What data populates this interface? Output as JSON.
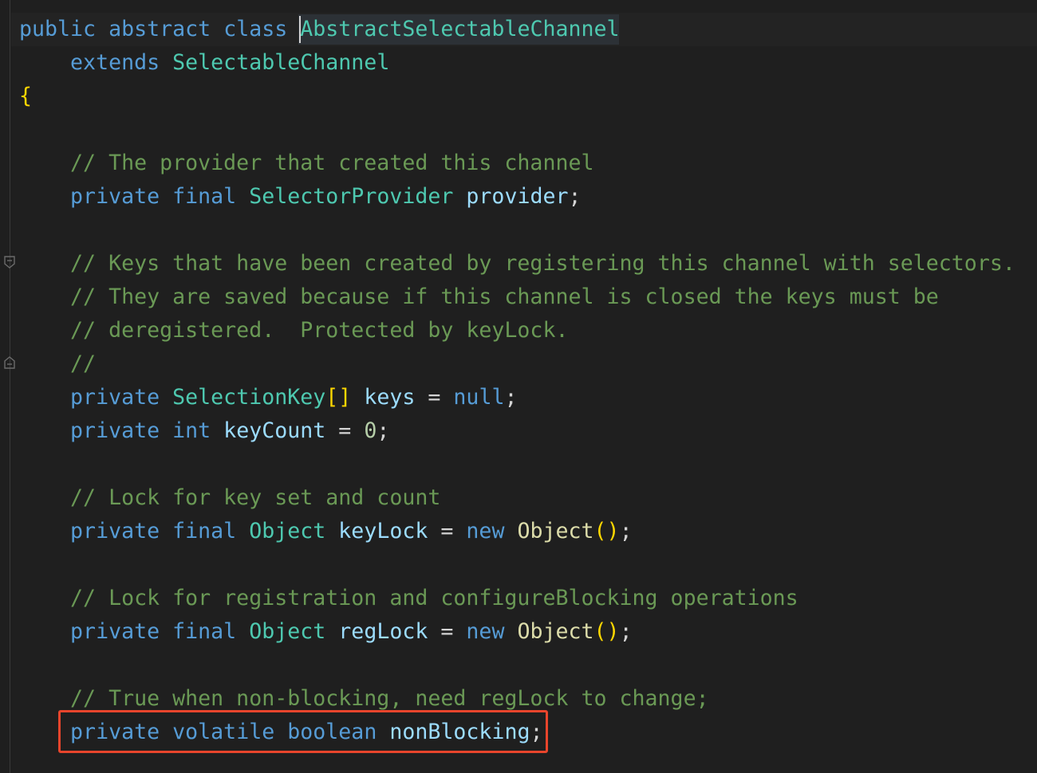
{
  "colors": {
    "background": "#1f1f1f",
    "keyword": "#569cd6",
    "type": "#4ec9b0",
    "variable": "#9cdcfe",
    "plain": "#d4d4d4",
    "comment": "#6a9955",
    "number": "#b5cea8",
    "function": "#dcdcaa",
    "bracket": "#ffd700",
    "highlight_box": "#e8452c"
  },
  "icons": [
    "fold-marker-icon"
  ],
  "code": {
    "lines": [
      [
        [
          "kw",
          "public "
        ],
        [
          "kw",
          "abstract "
        ],
        [
          "kw",
          "class "
        ],
        [
          "type",
          "AbstractSelectableChannel"
        ]
      ],
      [
        [
          "plain",
          "    "
        ],
        [
          "kw",
          "extends "
        ],
        [
          "type",
          "SelectableChannel"
        ]
      ],
      [
        [
          "br",
          "{"
        ]
      ],
      [],
      [
        [
          "plain",
          "    "
        ],
        [
          "cm",
          "// The provider that created this channel"
        ]
      ],
      [
        [
          "plain",
          "    "
        ],
        [
          "kw",
          "private "
        ],
        [
          "kw",
          "final "
        ],
        [
          "type",
          "SelectorProvider "
        ],
        [
          "var",
          "provider"
        ],
        [
          "plain",
          ";"
        ]
      ],
      [],
      [
        [
          "plain",
          "    "
        ],
        [
          "cm",
          "// Keys that have been created by registering this channel with selectors."
        ]
      ],
      [
        [
          "plain",
          "    "
        ],
        [
          "cm",
          "// They are saved because if this channel is closed the keys must be"
        ]
      ],
      [
        [
          "plain",
          "    "
        ],
        [
          "cm",
          "// deregistered.  Protected by keyLock."
        ]
      ],
      [
        [
          "plain",
          "    "
        ],
        [
          "cm",
          "//"
        ]
      ],
      [
        [
          "plain",
          "    "
        ],
        [
          "kw",
          "private "
        ],
        [
          "type",
          "SelectionKey"
        ],
        [
          "br",
          "[]"
        ],
        [
          "plain",
          " "
        ],
        [
          "var",
          "keys"
        ],
        [
          "plain",
          " = "
        ],
        [
          "kw",
          "null"
        ],
        [
          "plain",
          ";"
        ]
      ],
      [
        [
          "plain",
          "    "
        ],
        [
          "kw",
          "private "
        ],
        [
          "kw",
          "int "
        ],
        [
          "var",
          "keyCount"
        ],
        [
          "plain",
          " = "
        ],
        [
          "num",
          "0"
        ],
        [
          "plain",
          ";"
        ]
      ],
      [],
      [
        [
          "plain",
          "    "
        ],
        [
          "cm",
          "// Lock for key set and count"
        ]
      ],
      [
        [
          "plain",
          "    "
        ],
        [
          "kw",
          "private "
        ],
        [
          "kw",
          "final "
        ],
        [
          "type",
          "Object "
        ],
        [
          "var",
          "keyLock"
        ],
        [
          "plain",
          " = "
        ],
        [
          "kw",
          "new "
        ],
        [
          "fn",
          "Object"
        ],
        [
          "br",
          "()"
        ],
        [
          "plain",
          ";"
        ]
      ],
      [],
      [
        [
          "plain",
          "    "
        ],
        [
          "cm",
          "// Lock for registration and configureBlocking operations"
        ]
      ],
      [
        [
          "plain",
          "    "
        ],
        [
          "kw",
          "private "
        ],
        [
          "kw",
          "final "
        ],
        [
          "type",
          "Object "
        ],
        [
          "var",
          "regLock"
        ],
        [
          "plain",
          " = "
        ],
        [
          "kw",
          "new "
        ],
        [
          "fn",
          "Object"
        ],
        [
          "br",
          "()"
        ],
        [
          "plain",
          ";"
        ]
      ],
      [],
      [
        [
          "plain",
          "    "
        ],
        [
          "cm",
          "// True when non-blocking, need regLock to change;"
        ]
      ],
      [
        [
          "plain",
          "    "
        ],
        [
          "kw",
          "private "
        ],
        [
          "kw",
          "volatile "
        ],
        [
          "kw",
          "boolean "
        ],
        [
          "var",
          "nonBlocking"
        ],
        [
          "plain",
          ";"
        ]
      ]
    ]
  }
}
